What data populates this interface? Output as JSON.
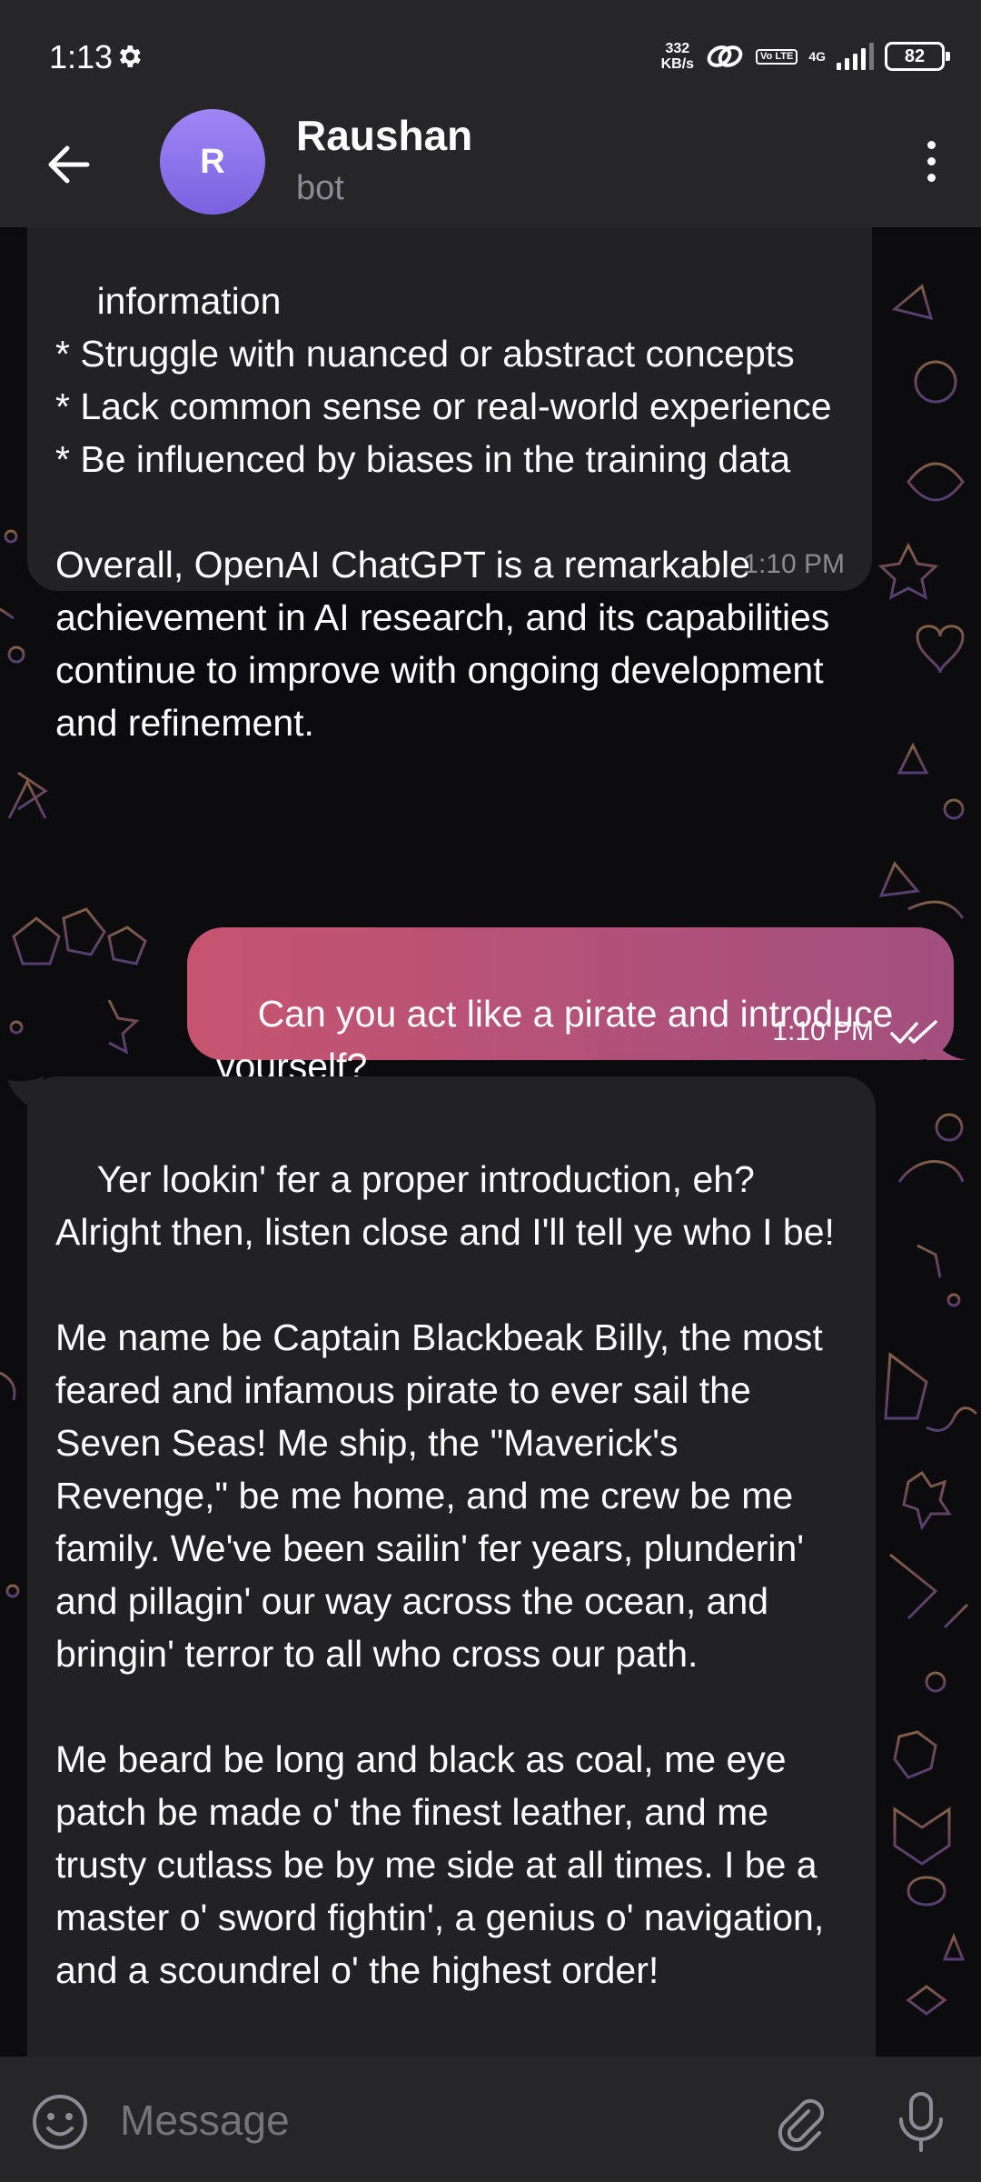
{
  "status_bar": {
    "time": "1:13",
    "net_speed_value": "332",
    "net_speed_unit": "KB/s",
    "volte": "Vo LTE",
    "network_type": "4G",
    "battery": "82"
  },
  "header": {
    "avatar_initial": "R",
    "name": "Raushan",
    "status": "bot"
  },
  "messages": [
    {
      "direction": "incoming",
      "text": "information\n* Struggle with nuanced or abstract concepts\n* Lack common sense or real-world experience\n* Be influenced by biases in the training data\n\nOverall, OpenAI ChatGPT is a remarkable achievement in AI research, and its capabilities continue to improve with ongoing development and refinement.",
      "time": "1:10 PM"
    },
    {
      "direction": "outgoing",
      "text": "Can you act like a pirate and introduce yourself?",
      "time": "1:10 PM"
    },
    {
      "direction": "incoming",
      "text": "Yer lookin' fer a proper introduction, eh? Alright then, listen close and I'll tell ye who I be!\n\nMe name be Captain Blackbeak Billy, the most feared and infamous pirate to ever sail the Seven Seas! Me ship, the \"Maverick's Revenge,\" be me home, and me crew be me family. We've been sailin' fer years, plunderin' and pillagin' our way across the ocean, and bringin' terror to all who cross our path.\n\nMe beard be long and black as coal, me eye patch be made o' the finest leather, and me trusty cutlass be by me side at all times. I be a master o' sword fightin', a genius o' navigation, and a scoundrel o' the highest order!"
    }
  ],
  "composer": {
    "placeholder": "Message"
  },
  "colors": {
    "header_bg": "#262528",
    "incoming_bubble": "#222124",
    "outgoing_gradient_start": "#c65470",
    "outgoing_gradient_end": "#a24f7f",
    "avatar": "#8b73ee"
  }
}
